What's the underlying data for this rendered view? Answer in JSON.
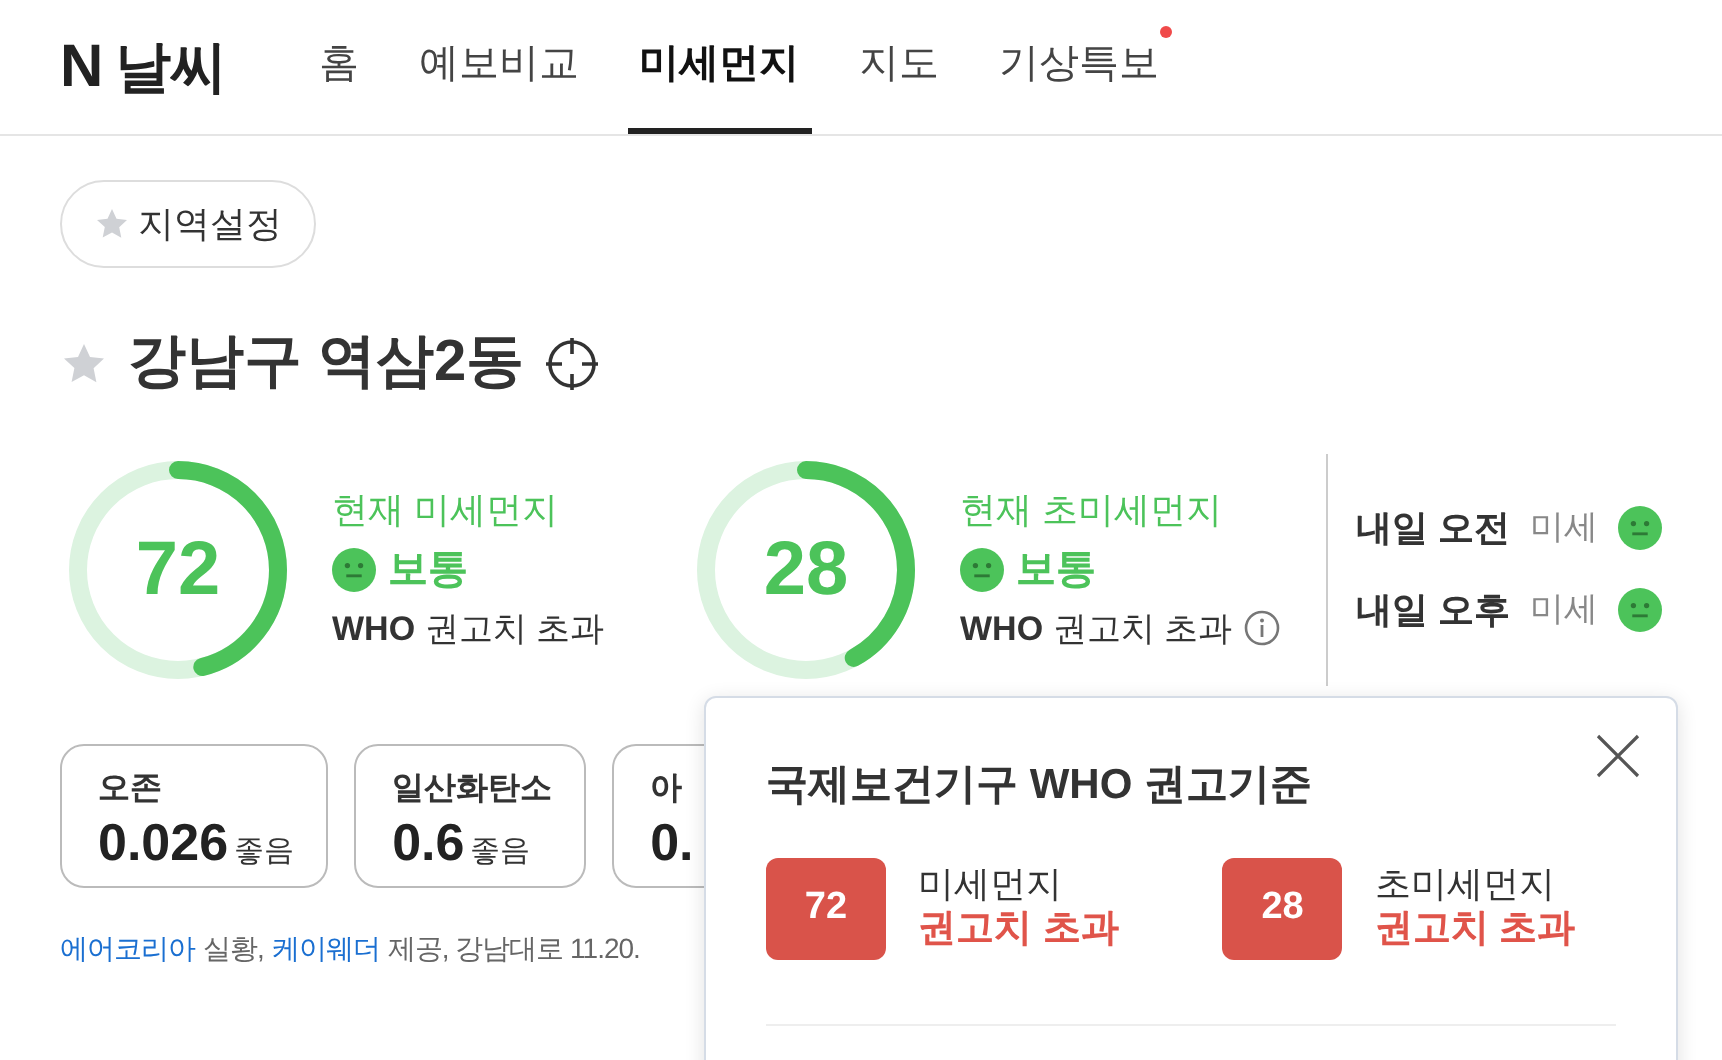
{
  "header": {
    "logo_mark": "N",
    "logo_text": "날씨",
    "tabs": [
      {
        "label": "홈",
        "selected": false,
        "alert": false
      },
      {
        "label": "예보비교",
        "selected": false,
        "alert": false
      },
      {
        "label": "미세먼지",
        "selected": true,
        "alert": false
      },
      {
        "label": "지도",
        "selected": false,
        "alert": false
      },
      {
        "label": "기상특보",
        "selected": false,
        "alert": true
      }
    ]
  },
  "region_button": {
    "label": "지역설정"
  },
  "location": {
    "name": "강남구 역삼2동",
    "favorite": false
  },
  "gauges": [
    {
      "value": "72",
      "level": 0.46,
      "title": "현재 미세먼지",
      "status": "보통",
      "who_prefix": "WHO",
      "who_text": "권고치 초과",
      "info": false
    },
    {
      "value": "28",
      "level": 0.42,
      "title": "현재 초미세먼지",
      "status": "보통",
      "who_prefix": "WHO",
      "who_text": "권고치 초과",
      "info": true
    }
  ],
  "forecast": [
    {
      "label": "내일 오전",
      "item": "미세"
    },
    {
      "label": "내일 오후",
      "item": "미세"
    }
  ],
  "cards": [
    {
      "label": "오존",
      "value": "0.026",
      "status": "좋음"
    },
    {
      "label": "일산화탄소",
      "value": "0.6",
      "status": "좋음"
    },
    {
      "label": "아",
      "value": "0."
    }
  ],
  "source": [
    {
      "text": "에어코리아",
      "kind": "link"
    },
    {
      "text": "실황,",
      "kind": "plain"
    },
    {
      "text": "케이웨더",
      "kind": "link"
    },
    {
      "text": "제공, 강남대로 11.20.",
      "kind": "plain"
    }
  ],
  "popup": {
    "title": "국제보건기구 WHO 권고기준",
    "items": [
      {
        "value": "72",
        "label": "미세먼지",
        "status": "권고치 초과"
      },
      {
        "value": "28",
        "label": "초미세먼지",
        "status": "권고치 초과"
      }
    ]
  }
}
